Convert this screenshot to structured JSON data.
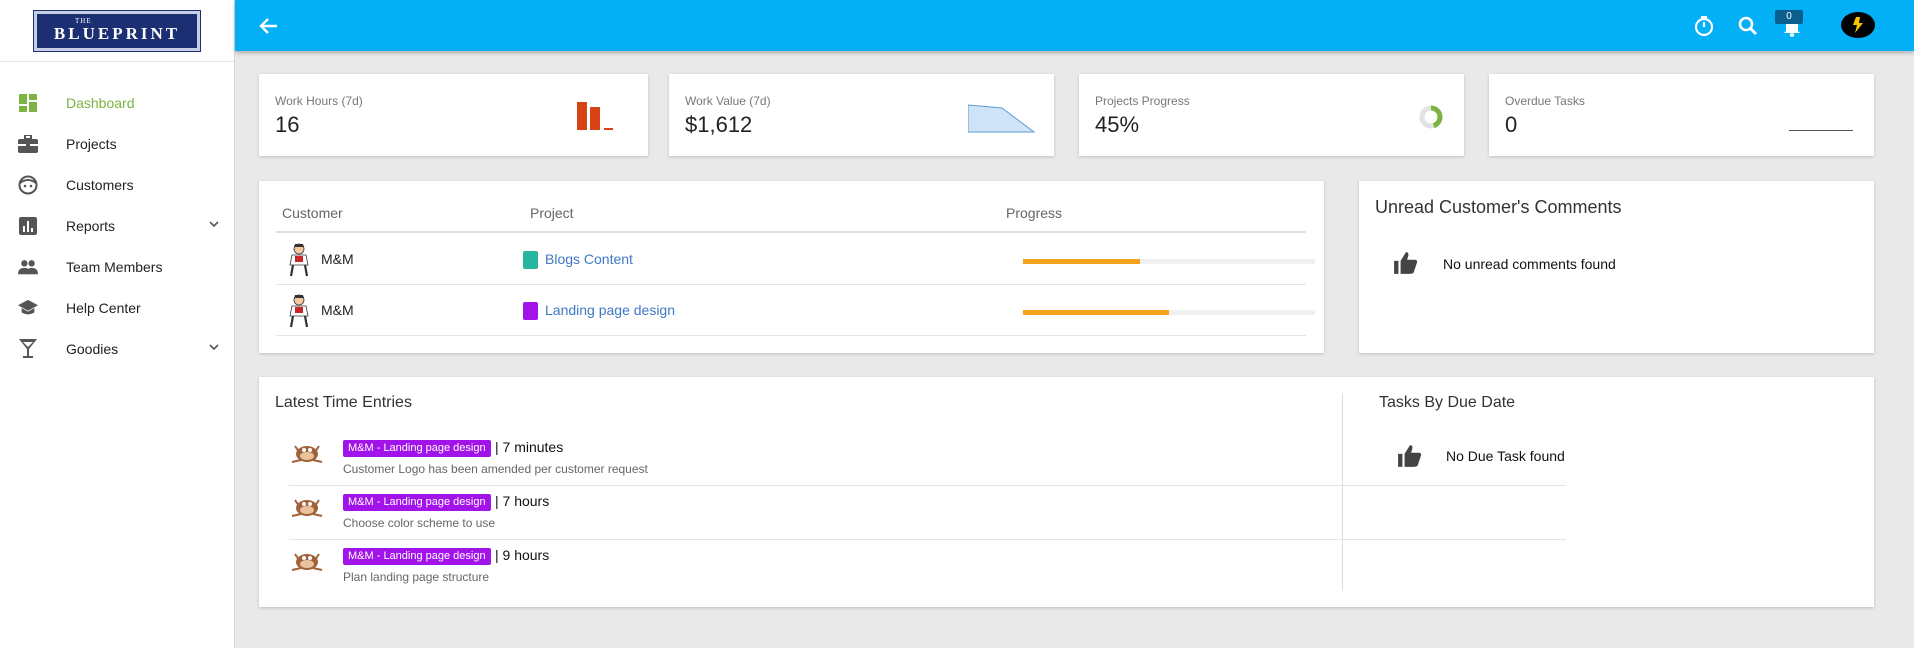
{
  "brand": {
    "logo_small": "THE",
    "logo_big": "BLUEPRINT"
  },
  "sidebar": {
    "items": [
      {
        "label": "Dashboard",
        "icon": "dashboard-icon",
        "active": true
      },
      {
        "label": "Projects",
        "icon": "briefcase-icon"
      },
      {
        "label": "Customers",
        "icon": "face-icon"
      },
      {
        "label": "Reports",
        "icon": "bar-chart-icon",
        "expandable": true
      },
      {
        "label": "Team Members",
        "icon": "people-icon"
      },
      {
        "label": "Help Center",
        "icon": "school-icon"
      },
      {
        "label": "Goodies",
        "icon": "cocktail-icon",
        "expandable": true
      }
    ]
  },
  "topbar": {
    "notifications_count": "0",
    "accent": "#03b0f5"
  },
  "stats": [
    {
      "label": "Work Hours (7d)",
      "value": "16"
    },
    {
      "label": "Work Value (7d)",
      "value": "$1,612"
    },
    {
      "label": "Projects Progress",
      "value": "45%",
      "progress": 0.45
    },
    {
      "label": "Overdue Tasks",
      "value": "0"
    }
  ],
  "projects_table": {
    "headers": [
      "Customer",
      "Project",
      "Progress"
    ],
    "rows": [
      {
        "customer": "M&M",
        "project": "Blogs Content",
        "color": "#26b6a0",
        "progress": 0.4
      },
      {
        "customer": "M&M",
        "project": "Landing page design",
        "color": "#a213ea",
        "progress": 0.5
      }
    ]
  },
  "comments": {
    "title": "Unread Customer's Comments",
    "empty": "No unread comments found"
  },
  "time_entries": {
    "title": "Latest Time Entries",
    "items": [
      {
        "tag": "M&M - Landing page design",
        "duration": "| 7 minutes",
        "description": "Customer Logo has been amended per customer request"
      },
      {
        "tag": "M&M - Landing page design",
        "duration": "| 7 hours",
        "description": "Choose color scheme to use"
      },
      {
        "tag": "M&M - Landing page design",
        "duration": "| 9 hours",
        "description": "Plan landing page structure"
      }
    ]
  },
  "due_tasks": {
    "title": "Tasks By Due Date",
    "empty": "No Due Task found"
  }
}
